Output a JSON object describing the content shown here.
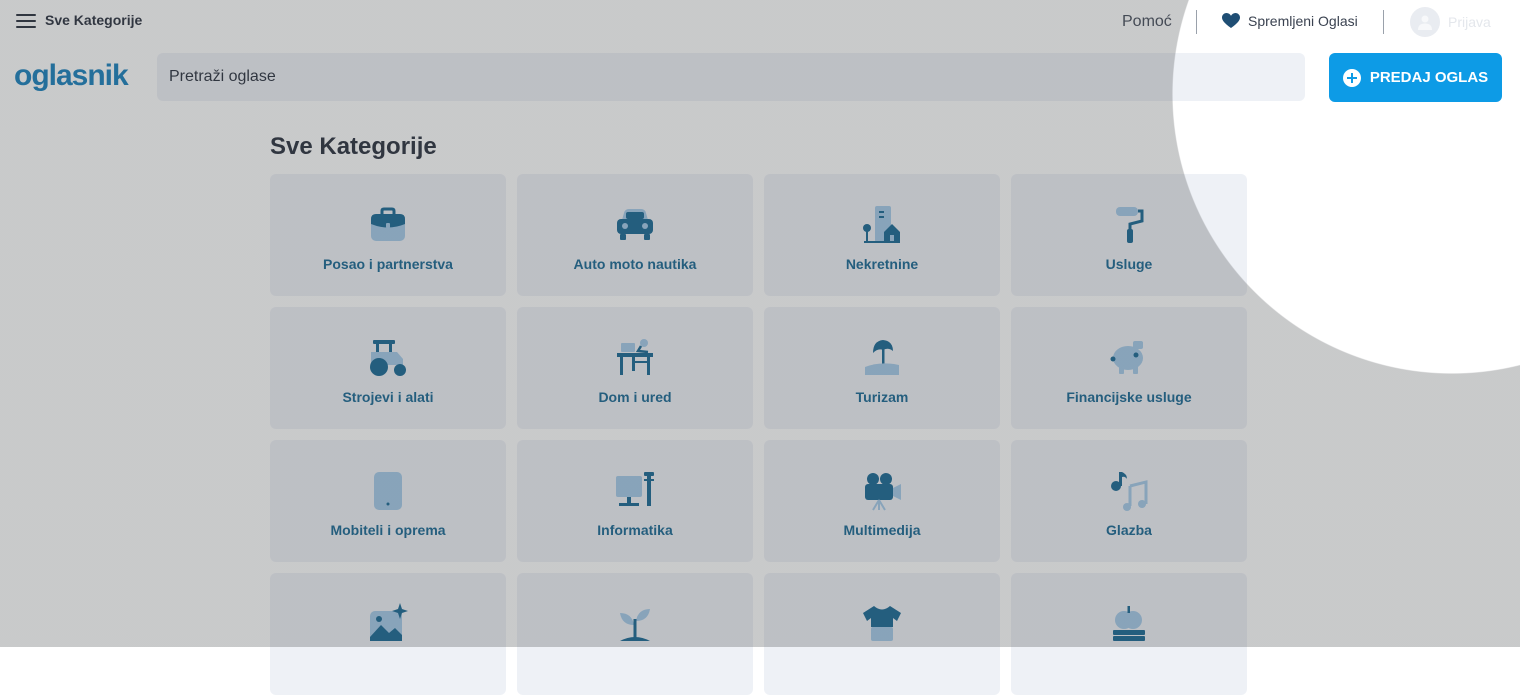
{
  "topnav": {
    "menu_label": "Sve Kategorije",
    "help": "Pomoć",
    "saved": "Spremljeni Oglasi",
    "login": "Prijava"
  },
  "header": {
    "logo": "oglasnik",
    "search_placeholder": "Pretraži oglase",
    "post_button": "PREDAJ OGLAS"
  },
  "page_title": "Sve Kategorije",
  "categories": [
    {
      "label": "Posao i partnerstva",
      "icon": "briefcase-icon"
    },
    {
      "label": "Auto moto nautika",
      "icon": "car-icon"
    },
    {
      "label": "Nekretnine",
      "icon": "building-icon"
    },
    {
      "label": "Usluge",
      "icon": "paint-roller-icon"
    },
    {
      "label": "Strojevi i alati",
      "icon": "tractor-icon"
    },
    {
      "label": "Dom i ured",
      "icon": "desk-icon"
    },
    {
      "label": "Turizam",
      "icon": "beach-umbrella-icon"
    },
    {
      "label": "Financijske usluge",
      "icon": "piggy-bank-icon"
    },
    {
      "label": "Mobiteli i oprema",
      "icon": "phone-icon"
    },
    {
      "label": "Informatika",
      "icon": "computer-icon"
    },
    {
      "label": "Multimedija",
      "icon": "video-camera-icon"
    },
    {
      "label": "Glazba",
      "icon": "music-notes-icon"
    },
    {
      "label": "",
      "icon": "image-sparkle-icon"
    },
    {
      "label": "",
      "icon": "sprout-icon"
    },
    {
      "label": "",
      "icon": "tshirt-icon"
    },
    {
      "label": "",
      "icon": "apple-books-icon"
    }
  ],
  "colors": {
    "accent": "#0d9be6",
    "icon_light": "#9ec6e6",
    "icon_dark": "#0a5e8c",
    "card_bg": "#eef1f6"
  }
}
